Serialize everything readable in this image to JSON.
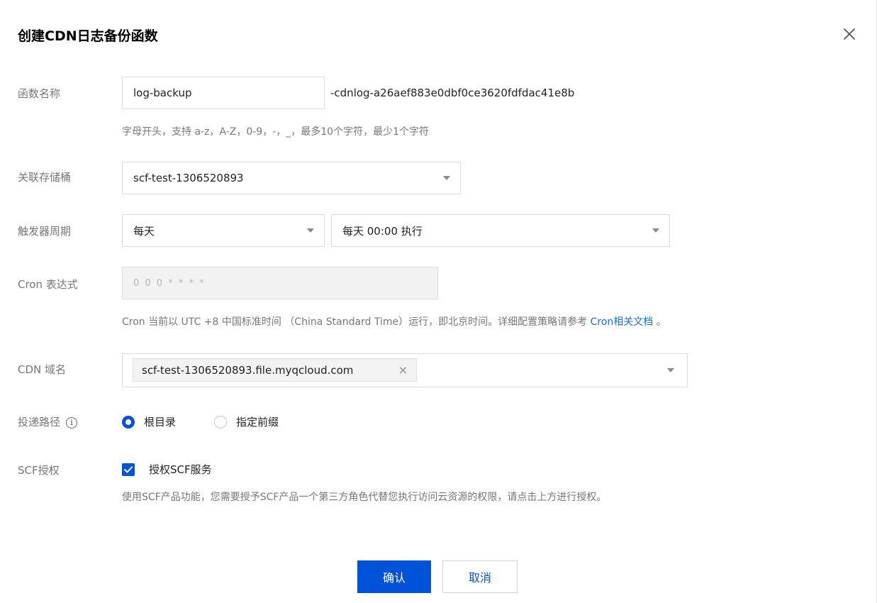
{
  "dialog": {
    "title": "创建CDN日志备份函数"
  },
  "form": {
    "function_name": {
      "label": "函数名称",
      "value": "log-backup",
      "suffix": "-cdnlog-a26aef883e0dbf0ce3620fdfdac41e8b",
      "hint": "字母开头，支持 a-z，A-Z，0-9，-，_，最多10个字符，最少1个字符"
    },
    "bucket": {
      "label": "关联存储桶",
      "value": "scf-test-1306520893"
    },
    "trigger": {
      "label": "触发器周期",
      "period_value": "每天",
      "time_value": "每天 00:00 执行"
    },
    "cron": {
      "label": "Cron 表达式",
      "value": "0 0 0 * * * *",
      "hint_prefix": "Cron 当前以 UTC +8 中国标准时间 （China Standard Time）运行，即北京时间。详细配置策略请参考 ",
      "hint_link": "Cron相关文档",
      "hint_suffix": " 。"
    },
    "cdn_domain": {
      "label": "CDN 域名",
      "tag": "scf-test-1306520893.file.myqcloud.com",
      "tag_remove": "×"
    },
    "delivery_path": {
      "label": "投递路径",
      "info_icon": "i",
      "options": [
        {
          "label": "根目录",
          "selected": true
        },
        {
          "label": "指定前缀",
          "selected": false
        }
      ]
    },
    "scf_auth": {
      "label": "SCF授权",
      "checkbox_label": "授权SCF服务",
      "checked": true,
      "hint": "使用SCF产品功能，您需要授予SCF产品一个第三方角色代替您执行访问云资源的权限，请点击上方进行授权。"
    }
  },
  "footer": {
    "confirm_label": "确认",
    "cancel_label": "取消"
  },
  "colors": {
    "primary": "#0052d9",
    "link": "#1a6fd1",
    "label": "#777777"
  },
  "icons": {
    "close": "close-icon",
    "caret": "caret-down-icon",
    "info": "info-icon",
    "check": "check-icon",
    "remove": "remove-tag-icon"
  }
}
